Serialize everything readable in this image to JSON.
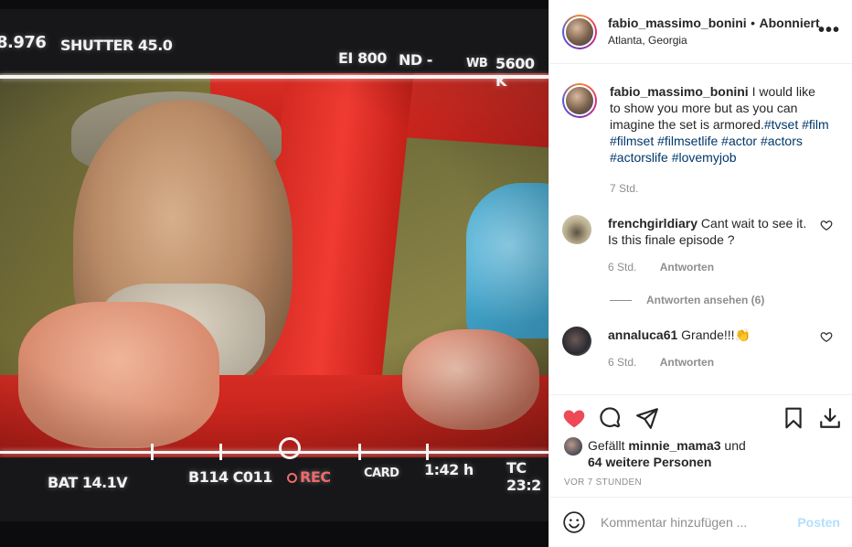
{
  "media": {
    "hud": {
      "iris": "8.976",
      "shutter": "SHUTTER 45.0",
      "ei": "EI 800",
      "nd": "ND -",
      "wb_label": "WB",
      "wb_value": "5600 K",
      "battery": "BAT 14.1V",
      "clip": "B114 C011",
      "rec": "REC",
      "card": "CARD",
      "remaining": "1:42 h",
      "timecode": "TC 23:2"
    }
  },
  "post": {
    "author": {
      "username": "fabio_massimo_bonini",
      "separator": "•",
      "follow_status": "Abonniert",
      "location": "Atlanta, Georgia"
    },
    "caption": {
      "username": "fabio_massimo_bonini",
      "text": "I would like to show you more but as you can imagine the set is armored.",
      "hashtags": [
        "#tvset",
        "#film",
        "#filmset",
        "#filmsetlife",
        "#actor",
        "#actors",
        "#actorslife",
        "#lovemyjob"
      ],
      "time": "7 Std."
    },
    "comments": [
      {
        "username": "frenchgirldiary",
        "text": "Cant wait to see it. Is this finale episode ?",
        "time": "6 Std.",
        "reply_label": "Antworten",
        "view_replies": "Antworten ansehen (6)"
      },
      {
        "username": "annaluca61",
        "text": "Grande!!!👏",
        "time": "6 Std.",
        "reply_label": "Antworten"
      }
    ],
    "likes": {
      "prefix": "Gefällt",
      "user": "minnie_mama3",
      "middle": "und",
      "others": "64 weitere Personen"
    },
    "posted_ago": "VOR 7 STUNDEN",
    "composer": {
      "placeholder": "Kommentar hinzufügen ...",
      "post_label": "Posten"
    },
    "colors": {
      "like_red": "#ed4956",
      "link_blue": "#00376b",
      "post_disabled": "#b2dffc"
    }
  }
}
